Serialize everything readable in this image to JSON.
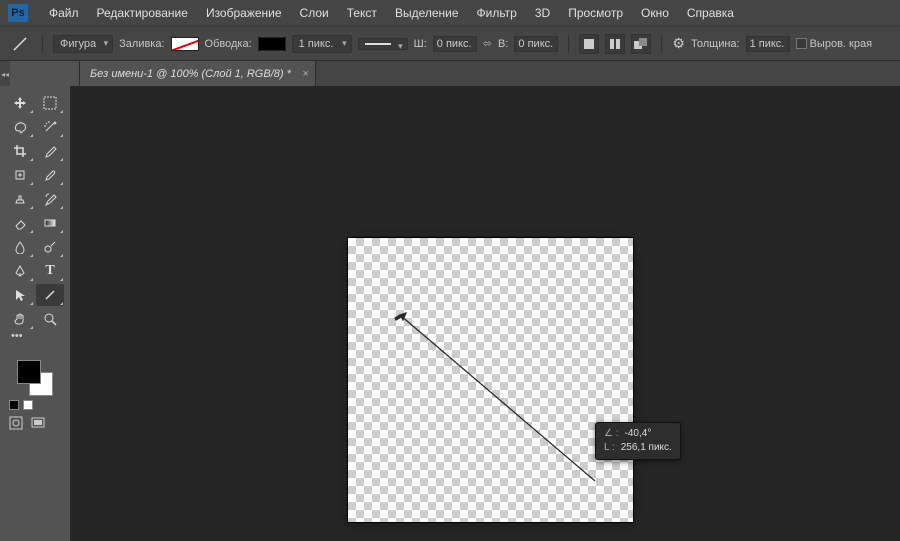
{
  "menubar": {
    "items": [
      "Файл",
      "Редактирование",
      "Изображение",
      "Слои",
      "Текст",
      "Выделение",
      "Фильтр",
      "3D",
      "Просмотр",
      "Окно",
      "Справка"
    ]
  },
  "appLogo": "Ps",
  "options": {
    "modeLabel": "Фигура",
    "fillLabel": "Заливка:",
    "strokeLabel": "Обводка:",
    "strokeWidth": "1 пикс.",
    "wLabel": "Ш:",
    "wVal": "0 пикс.",
    "hLabel": "В:",
    "hVal": "0 пикс.",
    "weightLabel": "Толщина:",
    "weightVal": "1 пикс.",
    "alignEdges": "Выров. края"
  },
  "docTab": {
    "title": "Без имени-1 @ 100% (Слой 1, RGB/8) *"
  },
  "tooltip": {
    "angleSym": "∠ :",
    "angleVal": "-40,4°",
    "lenSym": "L :",
    "lenVal": "256,1 пикс."
  },
  "toolbar": {
    "tools": [
      [
        "move",
        "marquee"
      ],
      [
        "lasso",
        "magic-wand"
      ],
      [
        "crop",
        "eyedropper"
      ],
      [
        "spot-heal",
        "brush"
      ],
      [
        "clone",
        "history-brush"
      ],
      [
        "eraser",
        "gradient"
      ],
      [
        "blur",
        "dodge"
      ],
      [
        "pen",
        "type"
      ],
      [
        "path-sel",
        "line"
      ],
      [
        "hand",
        "zoom"
      ]
    ],
    "selected": "line"
  }
}
